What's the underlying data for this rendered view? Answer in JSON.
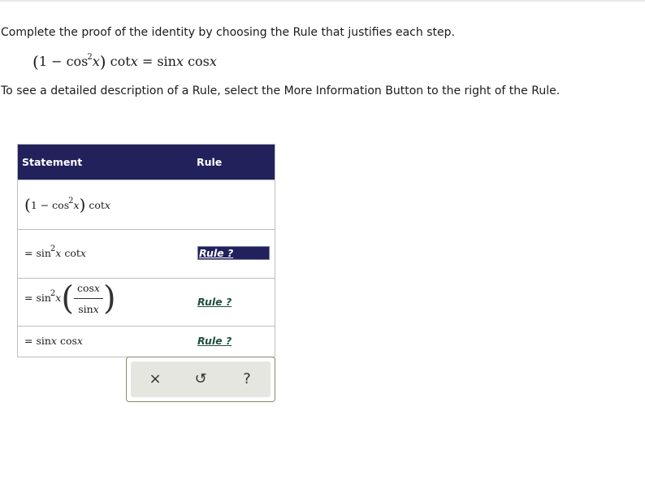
{
  "instructions": {
    "line1": "Complete the proof of the identity by choosing the Rule that justifies each step.",
    "line2": "To see a detailed description of a Rule, select the More Information Button to the right of the Rule."
  },
  "identity": {
    "open": "(",
    "one_minus": "1 − cos",
    "power": "2",
    "x": "x",
    "close": ")",
    "rest": " cot",
    "rest_x": "x",
    "equals": " = sin",
    "sin_x": "x",
    "cos": " cos",
    "cos_x": "x"
  },
  "table": {
    "headers": {
      "statement": "Statement",
      "rule": "Rule"
    },
    "rows": [
      {
        "open": "(",
        "body": "1 − cos",
        "power": "2",
        "x": "x",
        "close": ")",
        "tail": " cot",
        "tail_x": "x"
      },
      {
        "eq": "= ",
        "fn": "sin",
        "power": "2",
        "x": "x",
        "tail": " cot",
        "tail_x": "x",
        "rule": "Rule ?"
      },
      {
        "eq": "= ",
        "fn": "sin",
        "power": "2",
        "x": "x",
        "num": "cos",
        "num_x": "x",
        "den": "sin",
        "den_x": "x",
        "rule": "Rule ?"
      },
      {
        "eq": "= ",
        "fn": "sin",
        "x": "x",
        "tail": " cos",
        "tail_x": "x",
        "rule": "Rule ?"
      }
    ]
  },
  "toolbar": {
    "clear": "×",
    "undo": "↺",
    "help": "?"
  }
}
